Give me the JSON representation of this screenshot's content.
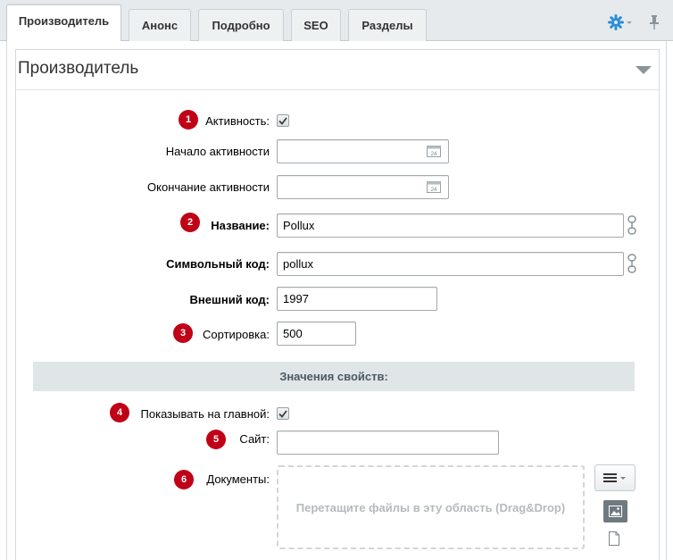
{
  "tabs": [
    {
      "label": "Производитель",
      "active": true
    },
    {
      "label": "Анонс"
    },
    {
      "label": "Подробно"
    },
    {
      "label": "SEO"
    },
    {
      "label": "Разделы"
    }
  ],
  "toolbar": {
    "settings_icon": "gear-icon",
    "pin_icon": "pin-icon"
  },
  "section": {
    "title": "Производитель"
  },
  "fields": {
    "active": {
      "badge": "1",
      "label": "Активность:",
      "checked": true
    },
    "start": {
      "label": "Начало активности",
      "value": ""
    },
    "end": {
      "label": "Окончание активности",
      "value": ""
    },
    "name": {
      "badge": "2",
      "label": "Название:",
      "value": "Pollux"
    },
    "code": {
      "label": "Символьный код:",
      "value": "pollux"
    },
    "ext_code": {
      "label": "Внешний код:",
      "value": "1997"
    },
    "sort": {
      "badge": "3",
      "label": "Сортировка:",
      "value": "500"
    }
  },
  "props": {
    "header": "Значения свойств:",
    "show_main": {
      "badge": "4",
      "label": "Показывать на главной:",
      "checked": true
    },
    "site": {
      "badge": "5",
      "label": "Сайт:",
      "value": ""
    },
    "docs": {
      "badge": "6",
      "label": "Документы:",
      "dropzone": "Перетащите файлы в эту область (Drag&Drop)"
    }
  },
  "colors": {
    "badge": "#c00016",
    "accent": "#2d8fd5",
    "props_bg": "#e0e6e8"
  }
}
